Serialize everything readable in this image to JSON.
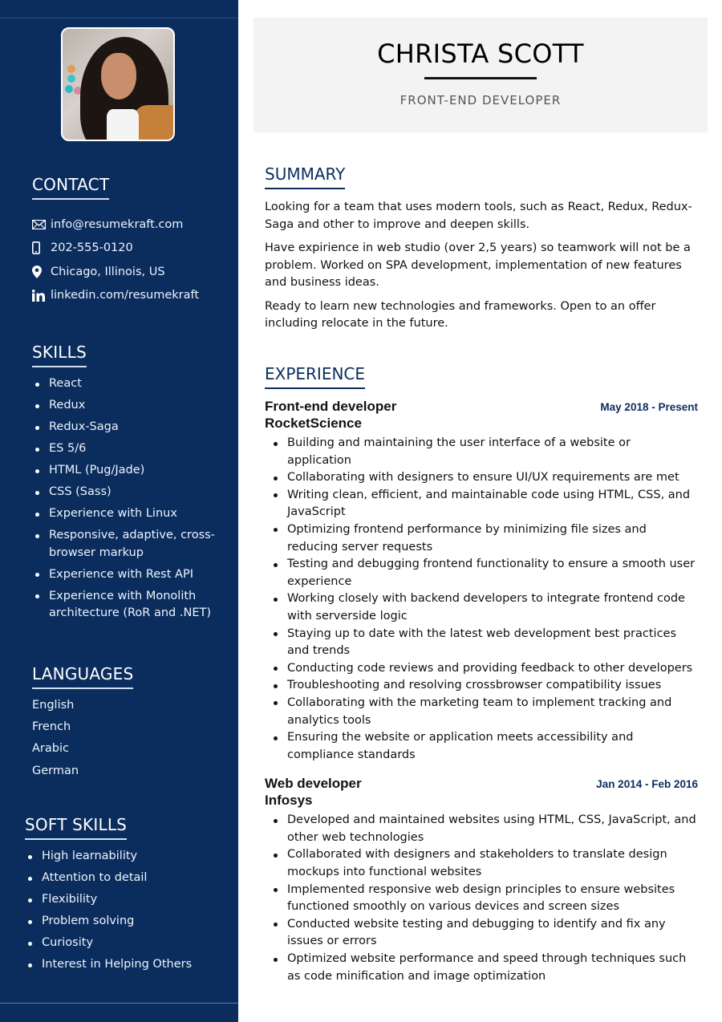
{
  "profile": {
    "name": "CHRISTA SCOTT",
    "role": "FRONT-END DEVELOPER",
    "photo_alt": "Portrait photo of Christa Scott"
  },
  "contact": {
    "heading": "CONTACT",
    "items": [
      {
        "icon": "envelope-icon",
        "text": "info@resumekraft.com"
      },
      {
        "icon": "phone-icon",
        "text": "202-555-0120"
      },
      {
        "icon": "location-pin-icon",
        "text": "Chicago, Illinois, US"
      },
      {
        "icon": "linkedin-icon",
        "text": "linkedin.com/resumekraft"
      }
    ]
  },
  "skills": {
    "heading": "SKILLS",
    "items": [
      "React",
      "Redux",
      "Redux-Saga",
      "ES 5/6",
      "HTML (Pug/Jade)",
      "CSS (Sass)",
      "Experience with Linux",
      "Responsive, adaptive, cross-browser markup",
      "Experience with Rest API",
      "Experience with Monolith architecture (RoR and .NET)"
    ]
  },
  "languages": {
    "heading": "LANGUAGES",
    "items": [
      "English",
      "French",
      "Arabic",
      "German"
    ]
  },
  "soft_skills": {
    "heading": "SOFT SKILLS",
    "items": [
      "High learnability",
      "Attention to detail",
      "Flexibility",
      "Problem solving",
      "Curiosity",
      "Interest in Helping Others"
    ]
  },
  "summary": {
    "heading": "SUMMARY",
    "paragraphs": [
      "Looking for a team that uses modern tools, such as React, Redux, Redux-Saga and other to improve and deepen skills.",
      "Have expirience in web studio (over 2,5 years) so teamwork will not be a problem. Worked on SPA development, implementation of new features and business ideas.",
      "Ready to learn new technologies and frameworks. Open to an offer including relocate in the future."
    ]
  },
  "experience": {
    "heading": "EXPERIENCE",
    "jobs": [
      {
        "title": "Front-end developer",
        "company": "RocketScience",
        "dates": "May 2018 - Present",
        "bullets": [
          "Building and maintaining the user interface of a website or application",
          "Collaborating with designers to ensure UI/UX requirements are met",
          "Writing clean, efficient, and maintainable code using HTML, CSS, and JavaScript",
          "Optimizing frontend performance by minimizing file sizes and reducing server requests",
          "Testing and debugging frontend functionality to ensure a smooth user experience",
          "Working closely with backend developers to integrate frontend code with serverside logic",
          "Staying up to date with the latest web development best practices and trends",
          "Conducting code reviews and providing feedback to other developers",
          "Troubleshooting and resolving crossbrowser compatibility issues",
          "Collaborating with the marketing team to implement tracking and analytics tools",
          "Ensuring the website or application meets accessibility and compliance standards"
        ]
      },
      {
        "title": "Web developer",
        "company": "Infosys",
        "dates": "Jan 2014 - Feb 2016",
        "bullets": [
          "Developed and maintained websites using HTML, CSS, JavaScript, and other web technologies",
          "Collaborated with designers and stakeholders to translate design mockups into functional websites",
          "Implemented responsive web design principles to ensure websites functioned smoothly on various devices and screen sizes",
          "Conducted website testing and debugging to identify and fix any issues or errors",
          "Optimized website performance and speed through techniques such as code minification and image optimization"
        ]
      }
    ]
  },
  "colors": {
    "sidebar_bg": "#0b2d5e",
    "accent": "#0b2d5e",
    "header_bg": "#f3f3f3",
    "text": "#111111"
  }
}
